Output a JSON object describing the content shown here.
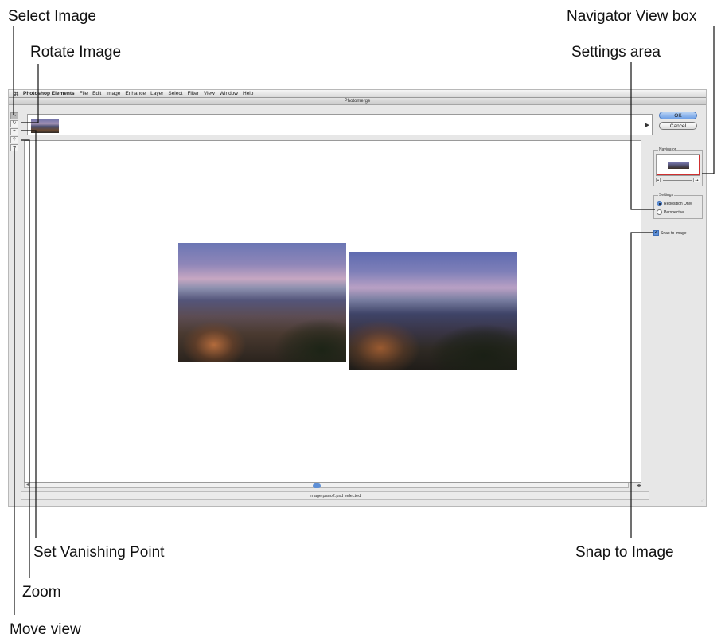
{
  "callouts": {
    "select_image": "Select Image",
    "rotate_image": "Rotate Image",
    "navigator_view_box": "Navigator View box",
    "settings_area": "Settings area",
    "set_vanishing_point": "Set Vanishing Point",
    "snap_to_image": "Snap to Image",
    "zoom": "Zoom",
    "move_view": "Move view"
  },
  "menubar": {
    "apple": "",
    "app_name": "Photoshop Elements",
    "items": [
      "File",
      "Edit",
      "Image",
      "Enhance",
      "Layer",
      "Select",
      "Filter",
      "View",
      "Window",
      "Help"
    ]
  },
  "window": {
    "title": "Photomerge"
  },
  "toolbox": {
    "select_image_glyph": "↖",
    "rotate_image_glyph": "↻",
    "vanishing_point_glyph": "⌖",
    "zoom_glyph": "🔍",
    "move_view_glyph": "✋"
  },
  "buttons": {
    "ok": "OK",
    "cancel": "Cancel"
  },
  "navigator": {
    "label": "Navigator"
  },
  "settings": {
    "label": "Settings",
    "options": [
      "Reposition Only",
      "Perspective"
    ],
    "selected": "Reposition Only"
  },
  "snap_to_image": {
    "label": "Snap to Image",
    "checked": true
  },
  "status": {
    "text": "Image pano2.psd selected"
  },
  "colors": {
    "accent": "#5e8fd6",
    "navigator_frame": "#d03030"
  },
  "icons": {
    "lightbox_scroll": "chevron-right-icon",
    "scroll_arrows": "arrows-icon"
  }
}
